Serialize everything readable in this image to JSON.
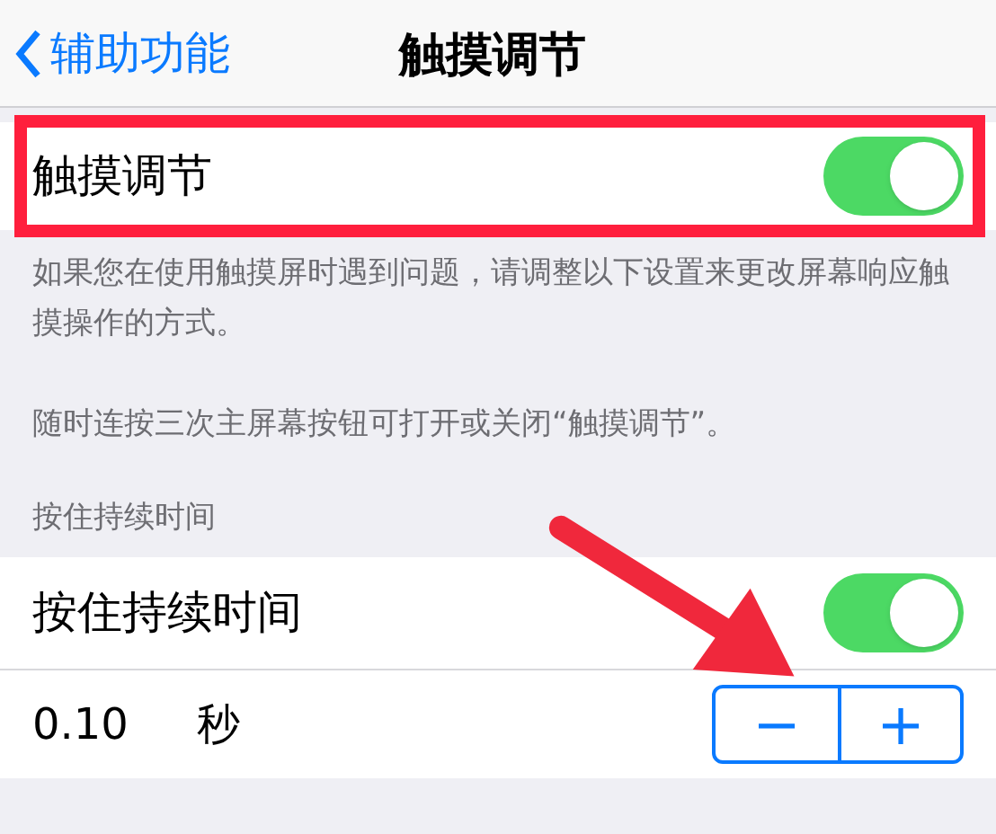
{
  "nav_bar": {
    "back": "辅助功能",
    "title": "触摸调节"
  },
  "main_switch": {
    "label": "触摸调节",
    "on": true
  },
  "footer_paragraphs": [
    "如果您在使用触摸屏时遇到问题，请调整以下设置来更改屏幕响应触摸操作的方式。",
    "随时连按三次主屏幕按钮可打开或关闭“触摸调节”。"
  ],
  "section_header": "按住持续时间",
  "hold_switch": {
    "label": "按住持续时间",
    "on": true
  },
  "duration": {
    "value": "0.10",
    "unit": "秒",
    "stepper": [
      "−",
      "+"
    ]
  }
}
